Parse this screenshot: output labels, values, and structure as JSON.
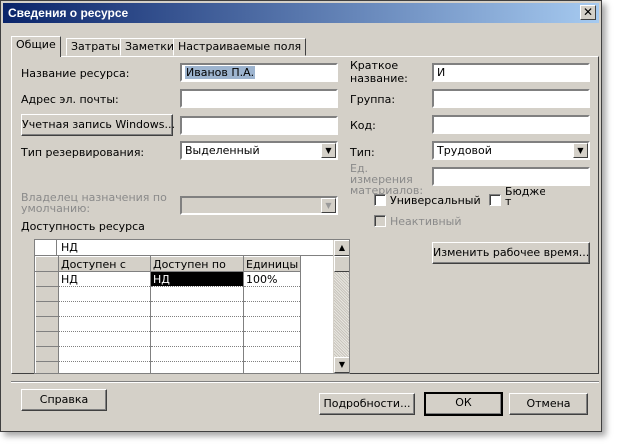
{
  "window": {
    "title": "Сведения о ресурсе",
    "close_glyph": "✕"
  },
  "tabs": [
    {
      "label": "Общие",
      "active": true
    },
    {
      "label": "Затраты",
      "active": false
    },
    {
      "label": "Заметки",
      "active": false
    },
    {
      "label": "Настраиваемые поля",
      "active": false
    }
  ],
  "form": {
    "resource_name_label": "Название ресурса:",
    "resource_name_value": "Иванов П.А.",
    "email_label": "Адрес эл. почты:",
    "email_value": "",
    "windows_account_button": "Учетная запись Windows...",
    "windows_account_value": "",
    "booking_type_label": "Тип резервирования:",
    "booking_type_value": "Выделенный",
    "assignment_owner_label": "Владелец назначения по умолчанию:",
    "assignment_owner_value": "",
    "short_name_label": "Краткое название:",
    "short_name_value": "И",
    "group_label": "Группа:",
    "group_value": "",
    "code_label": "Код:",
    "code_value": "",
    "type_label": "Тип:",
    "type_value": "Трудовой",
    "material_units_label": "Ед. измерения материалов:",
    "material_units_value": "",
    "generic_label": "Универсальный",
    "budget_label": "Бюдже т",
    "inactive_label": "Неактивный",
    "change_working_time_button": "Изменить рабочее время..."
  },
  "availability": {
    "section_label": "Доступность ресурса",
    "edit_value": "НД",
    "columns": [
      "Доступен с",
      "Доступен по",
      "Единицы"
    ],
    "rows": [
      [
        "НД",
        "НД",
        "100%"
      ]
    ],
    "empty_rows": 6
  },
  "footer": {
    "help_button": "Справка",
    "details_button": "Подробности...",
    "ok_button": "ОК",
    "cancel_button": "Отмена"
  },
  "icons": {
    "dropdown_arrow": "▼",
    "scroll_up": "▲",
    "scroll_down": "▼"
  }
}
